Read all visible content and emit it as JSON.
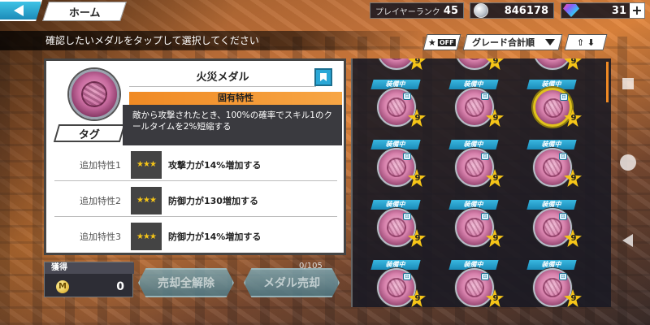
{
  "header": {
    "home_label": "ホーム",
    "player_rank_label": "プレイヤーランク",
    "player_rank_value": "45",
    "coins_value": "846178",
    "gems_value": "31",
    "plus_label": "+"
  },
  "instruction": "確認したいメダルをタップして選択してください",
  "filters": {
    "favorite_toggle": "OFF",
    "sort_label": "グレード合計順"
  },
  "detail": {
    "medal_name": "火災メダル",
    "tag_label": "タグ",
    "unique_header": "固有特性",
    "unique_text": "敵から攻撃されたとき、100%の確率でスキル1のクールタイムを2%短縮する",
    "traits": [
      {
        "label": "追加特性1",
        "stars": "★★★",
        "text": "攻撃力が14%増加する"
      },
      {
        "label": "追加特性2",
        "stars": "★★★",
        "text": "防御力が130増加する"
      },
      {
        "label": "追加特性3",
        "stars": "★★★",
        "text": "防御力が14%増加する"
      }
    ]
  },
  "bottom": {
    "acquired_label": "獲得",
    "m_icon": "M",
    "acquired_value": "0",
    "unsell_all_label": "売却全解除",
    "sell_label": "メダル売却",
    "sell_count": "0/105"
  },
  "grid": {
    "equipped_label": "装備中",
    "grade": "9",
    "lock_glyph": "⊡"
  }
}
